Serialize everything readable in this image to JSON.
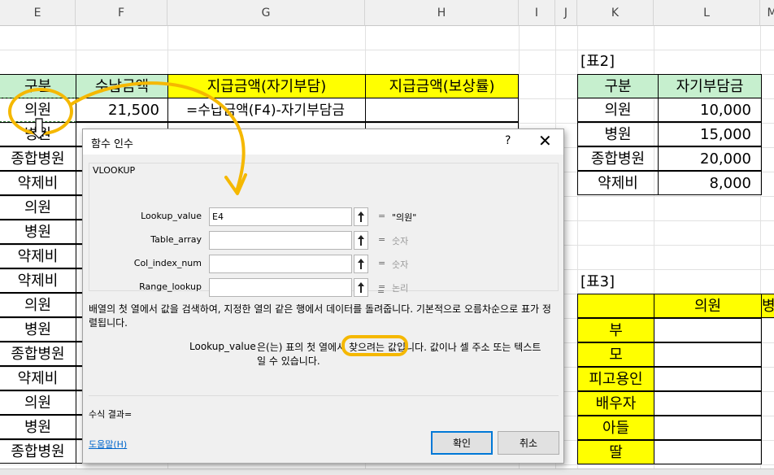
{
  "columns": [
    "E",
    "F",
    "G",
    "H",
    "I",
    "J",
    "K",
    "L",
    "M"
  ],
  "table1": {
    "headers": [
      "구분",
      "수납금액",
      "지급금액(자기부담)",
      "지급금액(보상률)"
    ],
    "first_row": {
      "category": "의원",
      "amount": "21,500",
      "formula": "=수납금액(F4)-자기부담금"
    },
    "categories": [
      "병원",
      "종합병원",
      "약제비",
      "의원",
      "병원",
      "약제비",
      "약제비",
      "의원",
      "병원",
      "종합병원",
      "약제비",
      "의원",
      "병원",
      "종합병원"
    ]
  },
  "table2": {
    "title": "[표2]",
    "headers": [
      "구분",
      "자기부담금"
    ],
    "rows": [
      {
        "category": "의원",
        "amount": "10,000"
      },
      {
        "category": "병원",
        "amount": "15,000"
      },
      {
        "category": "종합병원",
        "amount": "20,000"
      },
      {
        "category": "약제비",
        "amount": "8,000"
      }
    ]
  },
  "table3": {
    "title": "[표3]",
    "header_l": "의원",
    "header_m": "병원",
    "rows": [
      "부",
      "모",
      "피고용인",
      "배우자",
      "아들",
      "딸"
    ]
  },
  "dialog": {
    "title": "함수 인수",
    "help_symbol": "?",
    "close_symbol": "✕",
    "function_name": "VLOOKUP",
    "args": [
      {
        "label": "Lookup_value",
        "value": "E4",
        "result": "\"의원\""
      },
      {
        "label": "Table_array",
        "value": "",
        "result": "숫자"
      },
      {
        "label": "Col_index_num",
        "value": "",
        "result": "숫자"
      },
      {
        "label": "Range_lookup",
        "value": "",
        "result": "논리"
      }
    ],
    "equals": "=",
    "description": "배열의 첫 열에서 값을 검색하여, 지정한 열의 같은 행에서 데이터를 돌려줍니다. 기본적으로 오름차순으로 표가 정렬됩니다.",
    "arg_desc_name": "Lookup_value",
    "arg_desc_text": "은(는) 표의 첫 열에서 찾으려는 값입니다. 값이나 셀 주소 또는 텍스트일 수 있습니다.",
    "formula_result": "수식 결과=",
    "help_link": "도움말(H)",
    "ok_label": "확인",
    "cancel_label": "취소"
  },
  "colors": {
    "header_green": "#c6efce",
    "header_yellow": "#ffff00",
    "annotation": "#f5b800"
  }
}
